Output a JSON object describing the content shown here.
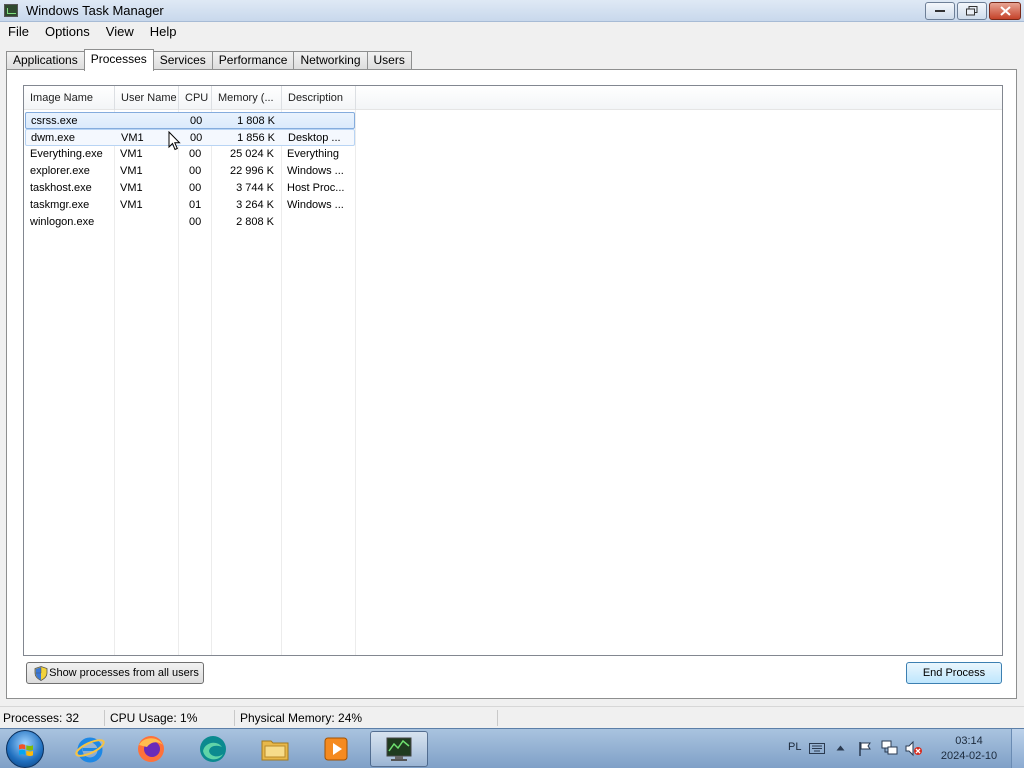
{
  "window": {
    "title": "Windows Task Manager"
  },
  "menu": [
    "File",
    "Options",
    "View",
    "Help"
  ],
  "tabs": [
    "Applications",
    "Processes",
    "Services",
    "Performance",
    "Networking",
    "Users"
  ],
  "active_tab": "Processes",
  "columns": {
    "name": "Image Name",
    "user": "User Name",
    "cpu": "CPU",
    "memory": "Memory (...",
    "description": "Description"
  },
  "processes": [
    {
      "name": "csrss.exe",
      "user": "",
      "cpu": "00",
      "memory": "1 808 K",
      "description": ""
    },
    {
      "name": "dwm.exe",
      "user": "VM1",
      "cpu": "00",
      "memory": "1 856 K",
      "description": "Desktop ..."
    },
    {
      "name": "Everything.exe",
      "user": "VM1",
      "cpu": "00",
      "memory": "25 024 K",
      "description": "Everything"
    },
    {
      "name": "explorer.exe",
      "user": "VM1",
      "cpu": "00",
      "memory": "22 996 K",
      "description": "Windows ..."
    },
    {
      "name": "taskhost.exe",
      "user": "VM1",
      "cpu": "00",
      "memory": "3 744 K",
      "description": "Host Proc..."
    },
    {
      "name": "taskmgr.exe",
      "user": "VM1",
      "cpu": "01",
      "memory": "3 264 K",
      "description": "Windows ..."
    },
    {
      "name": "winlogon.exe",
      "user": "",
      "cpu": "00",
      "memory": "2 808 K",
      "description": ""
    }
  ],
  "buttons": {
    "show_all": "Show processes from all users",
    "end_process": "End Process"
  },
  "status": {
    "processes": "Processes: 32",
    "cpu": "CPU Usage: 1%",
    "memory": "Physical Memory: 24%"
  },
  "taskbar": {
    "apps": [
      "internet-explorer-icon",
      "firefox-icon",
      "edge-beta-icon",
      "file-explorer-icon",
      "media-player-icon",
      "task-manager-icon"
    ],
    "language": "PL",
    "time": "03:14",
    "date": "2024-02-10"
  },
  "colors": {
    "selection_border": "#84acdd",
    "taskbar_top": "#a9c3df",
    "close_button": "#c5432a"
  }
}
